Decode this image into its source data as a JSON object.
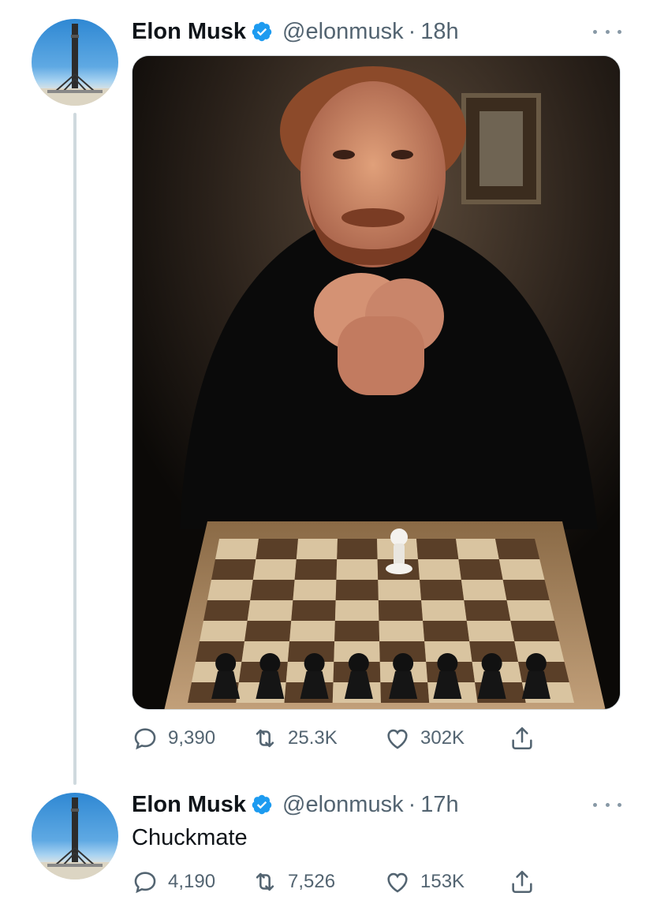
{
  "thread": {
    "tweets": [
      {
        "author_name": "Elon Musk",
        "handle": "@elonmusk",
        "separator": "·",
        "time": "18h",
        "text": "",
        "media": {
          "kind": "photo",
          "description_icon": "photo-icon"
        },
        "stats": {
          "replies": "9,390",
          "retweets": "25.3K",
          "likes": "302K"
        }
      },
      {
        "author_name": "Elon Musk",
        "handle": "@elonmusk",
        "separator": "·",
        "time": "17h",
        "text": "Chuckmate",
        "stats": {
          "replies": "4,190",
          "retweets": "7,526",
          "likes": "153K"
        }
      }
    ]
  },
  "colors": {
    "verified": "#1d9bf0",
    "secondary_text": "#536471",
    "thread_line": "#cfd9de"
  },
  "icons": [
    "verified-badge-icon",
    "more-icon",
    "reply-icon",
    "retweet-icon",
    "like-icon",
    "share-icon"
  ]
}
